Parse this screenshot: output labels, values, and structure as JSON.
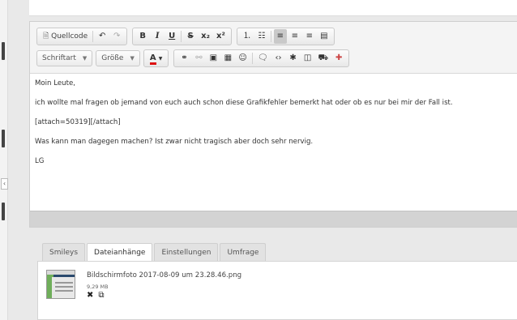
{
  "toolbar": {
    "row1": {
      "source_label": "Quellcode",
      "bold": "B",
      "italic": "I",
      "underline": "U",
      "strike": "S",
      "subscript": "x₂",
      "superscript": "x²"
    },
    "row2": {
      "font_label": "Schriftart",
      "size_label": "Größe",
      "text_color": "A"
    }
  },
  "content": {
    "lines": [
      "Moin Leute,",
      "ich wollte mal fragen ob jemand von euch auch schon diese Grafikfehler bemerkt hat oder ob es nur bei mir der Fall ist.",
      "[attach=50319][/attach]",
      "Was kann man dagegen machen? Ist zwar nicht tragisch aber doch sehr nervig.",
      "LG"
    ]
  },
  "tabs": [
    {
      "label": "Smileys",
      "active": false
    },
    {
      "label": "Dateianhänge",
      "active": true
    },
    {
      "label": "Einstellungen",
      "active": false
    },
    {
      "label": "Umfrage",
      "active": false
    }
  ],
  "attachment": {
    "filename": "Bildschirmfoto 2017-08-09 um 23.28.46.png",
    "size": "9,29 MB"
  },
  "icons": {
    "source": "document-icon",
    "undo": "undo-icon",
    "redo": "redo-icon",
    "delete": "close-icon",
    "insert": "insert-icon"
  }
}
